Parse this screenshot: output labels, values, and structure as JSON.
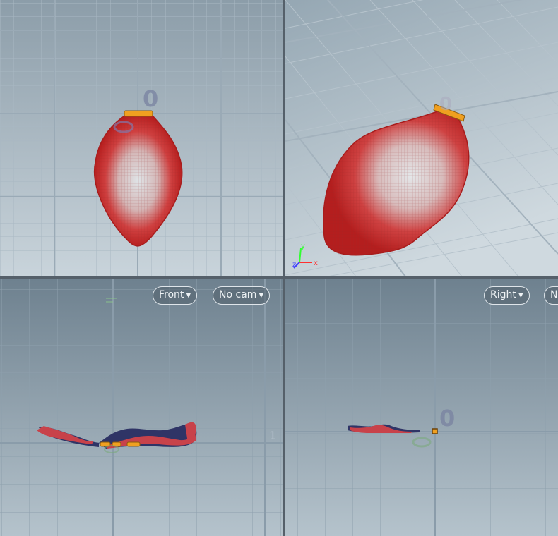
{
  "viewports": {
    "top": {
      "origin_label": "0"
    },
    "perspective": {
      "origin_label": "0"
    },
    "front": {
      "view_menu": "Front",
      "camera_menu": "No cam",
      "tick_label": "1"
    },
    "right": {
      "view_menu": "Right",
      "camera_menu": "No cam",
      "origin_label": "0"
    }
  },
  "colors": {
    "mesh_red": "#c62a2a",
    "mesh_highlight": "#d8dfe4",
    "mesh_back": "#2f3466",
    "handle_orange": "#f0a020",
    "grid_line": "#9fb0bd",
    "axis_x": "#ff3030",
    "axis_y": "#30ff30",
    "axis_z": "#4040ff"
  }
}
